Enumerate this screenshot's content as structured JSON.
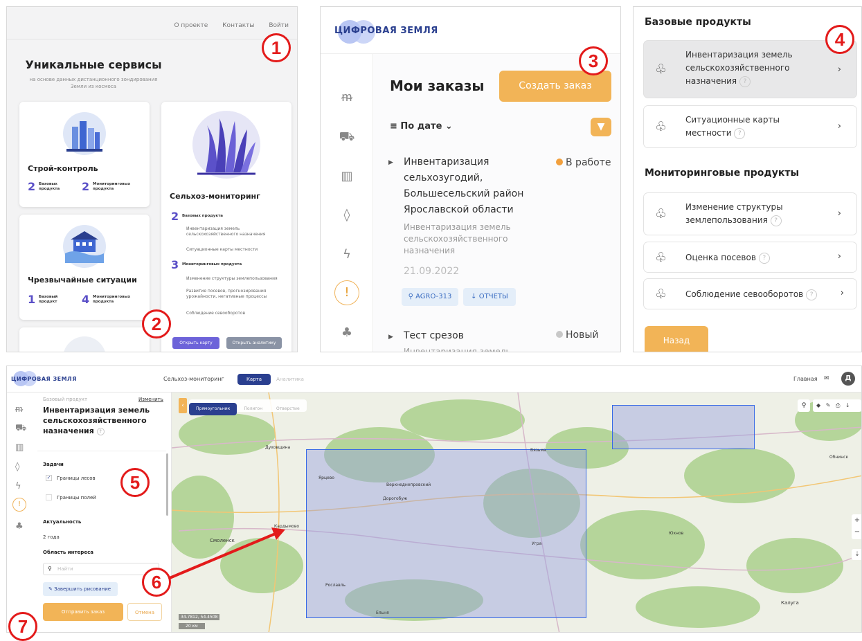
{
  "callouts": [
    "1",
    "2",
    "3",
    "4",
    "5",
    "6",
    "7"
  ],
  "panel1": {
    "nav": [
      "О проекте",
      "Контакты",
      "Войти"
    ],
    "title": "Уникальные сервисы",
    "subtitle_line1": "на основе данных дистанционного зондирования",
    "subtitle_line2": "Земли из космоса",
    "card_build": {
      "title": "Строй-контроль",
      "n1": "2",
      "l1": "Базовых продукта",
      "n2": "2",
      "l2": "Мониторинговых продукта"
    },
    "card_emergency": {
      "title": "Чрезвычайные ситуации",
      "n1": "1",
      "l1": "Базовый продукт",
      "n2": "4",
      "l2": "Мониторинговых продукта"
    },
    "card_agro": {
      "title": "Сельхоз-мониторинг",
      "n1": "2",
      "l1": "Базовых продукта",
      "b1": "Инвентаризация земель сельскохозяйственного назначения",
      "b2": "Ситуационные карты местности",
      "n2": "3",
      "l2": "Мониторинговых продукта",
      "m1": "Изменение структуры землепользования",
      "m2": "Развитие посевов, прогнозирования урожайности, негативные процессы",
      "m3": "Соблюдение севооборотов",
      "btn_map": "Открыть карту",
      "btn_analytics": "Открыть аналитику"
    }
  },
  "panel2": {
    "brand": "ЦИФРОВАЯ ЗЕМЛЯ",
    "title": "Мои заказы",
    "create": "Создать заказ",
    "sort": "По дате",
    "order1": {
      "name_1": "Инвентаризация",
      "name_2": "сельхозугодий,",
      "name_3": "Большесельский район",
      "name_4": "Ярославской области",
      "desc_1": "Инвентаризация земель",
      "desc_2": "сельскохозяйственного",
      "desc_3": "назначения",
      "date": "21.09.2022",
      "status": "В работе",
      "tag1": "AGRO-313",
      "tag2": "ОТЧЕТЫ"
    },
    "order2": {
      "name": "Тест срезов",
      "desc": "Инвентаризация земель",
      "status": "Новый"
    },
    "colors": {
      "accent": "#f2b457",
      "in_work": "#f2a03d",
      "new": "#c8c8c8"
    }
  },
  "panel3": {
    "base_title": "Базовые продукты",
    "base": [
      {
        "l1": "Инвентаризация земель",
        "l2": "сельскохозяйственного",
        "l3": "назначения"
      },
      {
        "l1": "Ситуационные карты",
        "l2": "местности"
      }
    ],
    "mon_title": "Мониторинговые продукты",
    "mon": [
      {
        "l1": "Изменение структуры",
        "l2": "землепользования"
      },
      {
        "l1": "Оценка посевов"
      },
      {
        "l1": "Соблюдение севооборотов"
      }
    ],
    "back": "Назад"
  },
  "panel4": {
    "brand": "ЦИФРОВАЯ ЗЕМЛЯ",
    "service": "Сельхоз-мониторинг",
    "tab_map": "Карта",
    "tab_analytics": "Аналитика",
    "home": "Главная",
    "avatar": "Д",
    "product_caption": "Базовый продукт",
    "change": "Изменить",
    "product_l1": "Инвентаризация земель",
    "product_l2": "сельскохозяйственного",
    "product_l3": "назначения",
    "tasks": "Задачи",
    "task1": "Границы лесов",
    "task2": "Границы полей",
    "actuality": "Актуальность",
    "actuality_val": "2 года",
    "area": "Область интереса",
    "search_ph": "Найти",
    "finish": "Завершить рисование",
    "send": "Отправить заказ",
    "cancel": "Отмена",
    "draw_modes": [
      "Прямоугольник",
      "Полигон",
      "Отверстие"
    ],
    "coords": "34.7812, 54.4508",
    "scale": "20 км",
    "places": [
      "Смоленск",
      "Ярцево",
      "Духовщина",
      "Вязьма",
      "Ельня",
      "Рославль",
      "Юхнов",
      "Калуга",
      "Обнинск",
      "Угра",
      "Дорогобуж",
      "Верхнеднепровский",
      "Кардымово",
      "Юхнов"
    ]
  }
}
